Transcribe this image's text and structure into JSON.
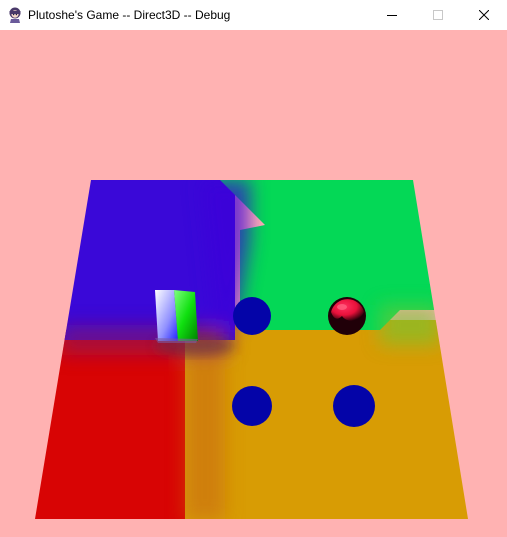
{
  "window": {
    "title": "Plutoshe's Game -- Direct3D -- Debug",
    "app_icon": "anime-girl-icon",
    "controls": {
      "minimize_icon": "minimize-icon",
      "maximize_icon": "maximize-icon",
      "close_icon": "close-icon"
    }
  },
  "scene": {
    "background_color": "#ffb2b2",
    "floor_quadrants": {
      "top_left": "#3a08d8",
      "top_right": "#04d856",
      "bottom_left": "#d80404",
      "bottom_right": "#d89c04"
    },
    "blue_ball_color": "#0404a8",
    "player_ball_colors": [
      "#e8103a",
      "#200008"
    ],
    "cube_colors": [
      "#ffffff",
      "#10e010",
      "#0000ff"
    ],
    "objects": [
      {
        "name": "blue-ball",
        "count": 3
      },
      {
        "name": "player-ball",
        "count": 1
      },
      {
        "name": "cube",
        "count": 1
      }
    ]
  }
}
